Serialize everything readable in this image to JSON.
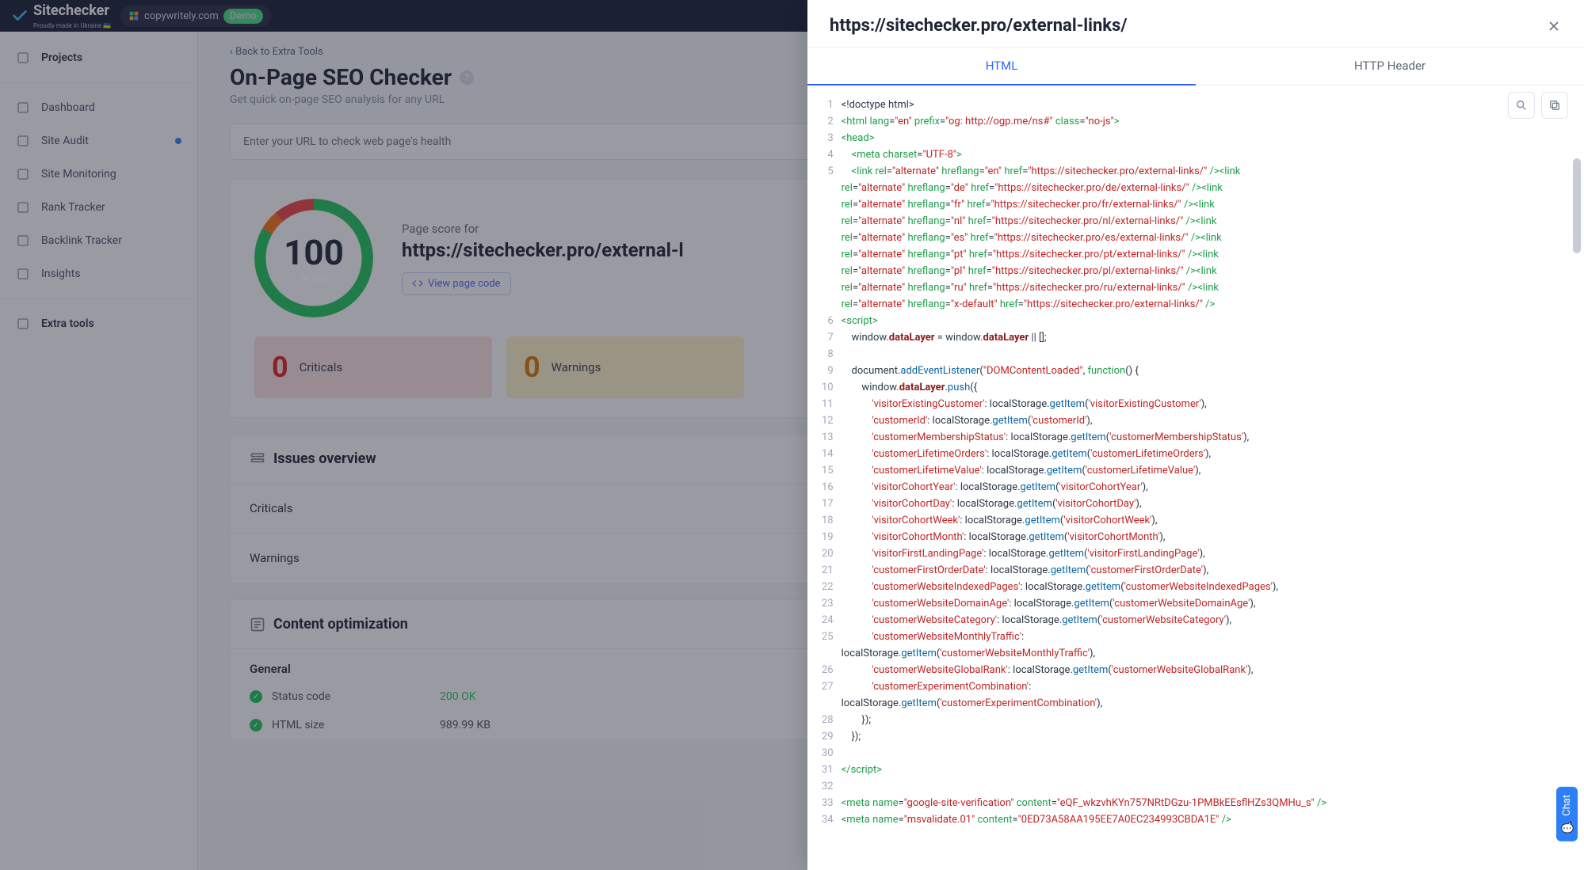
{
  "header": {
    "logo_name": "Sitechecker",
    "logo_sub": "Proudly made in Ukraine 🇺🇦",
    "demo_site": "copywritely.com",
    "demo_badge": "Demo"
  },
  "sidebar": {
    "items": [
      {
        "label": "Projects",
        "icon": "home-icon",
        "group": true
      },
      {
        "label": "Dashboard",
        "icon": "dashboard-icon"
      },
      {
        "label": "Site Audit",
        "icon": "audit-icon",
        "dot": true
      },
      {
        "label": "Site Monitoring",
        "icon": "monitor-icon"
      },
      {
        "label": "Rank Tracker",
        "icon": "rank-icon"
      },
      {
        "label": "Backlink Tracker",
        "icon": "backlink-icon"
      },
      {
        "label": "Insights",
        "icon": "insights-icon"
      },
      {
        "label": "Extra tools",
        "icon": "extra-icon",
        "group": true
      }
    ]
  },
  "main": {
    "back": "Back to Extra Tools",
    "title": "On-Page SEO Checker",
    "subtitle": "Get quick on-page SEO analysis for any URL",
    "input_placeholder": "Enter your URL to check web page's health",
    "score": {
      "value": "100",
      "of": "of 100",
      "label": "Page score for",
      "url": "https://sitechecker.pro/external-l",
      "view_code": "View page code"
    },
    "counts": {
      "criticals_n": "0",
      "criticals_t": "Criticals",
      "warn_n": "0",
      "warn_t": "Warnings"
    },
    "issues_h": "Issues overview",
    "criticals_row": "Criticals",
    "warnings_row": "Warnings",
    "content_h": "Content optimization",
    "general": "General",
    "status_k": "Status code",
    "status_v": "200 OK",
    "size_k": "HTML size",
    "size_v": "989.99 KB"
  },
  "drawer": {
    "title": "https://sitechecker.pro/external-links/",
    "tab_html": "HTML",
    "tab_header": "HTTP Header"
  },
  "code_lines": [
    [
      [
        "pun",
        "<!doctype html>"
      ]
    ],
    [
      [
        "tag",
        "<html "
      ],
      [
        "attr",
        "lang"
      ],
      [
        "pun",
        "="
      ],
      [
        "val",
        "\"en\""
      ],
      [
        "pun",
        " "
      ],
      [
        "attr",
        "prefix"
      ],
      [
        "pun",
        "="
      ],
      [
        "val",
        "\"og: http://ogp.me/ns#\""
      ],
      [
        "pun",
        " "
      ],
      [
        "attr",
        "class"
      ],
      [
        "pun",
        "="
      ],
      [
        "val",
        "\"no-js\""
      ],
      [
        "tag",
        ">"
      ]
    ],
    [
      [
        "tag",
        "<head>"
      ]
    ],
    [
      [
        "pun",
        "    "
      ],
      [
        "tag",
        "<meta "
      ],
      [
        "attr",
        "charset"
      ],
      [
        "pun",
        "="
      ],
      [
        "val",
        "\"UTF-8\""
      ],
      [
        "tag",
        ">"
      ]
    ],
    [
      [
        "pun",
        "    "
      ],
      [
        "tag",
        "<link "
      ],
      [
        "attr",
        "rel"
      ],
      [
        "pun",
        "="
      ],
      [
        "val",
        "\"alternate\""
      ],
      [
        "pun",
        " "
      ],
      [
        "attr",
        "hreflang"
      ],
      [
        "pun",
        "="
      ],
      [
        "val",
        "\"en\""
      ],
      [
        "pun",
        " "
      ],
      [
        "attr",
        "href"
      ],
      [
        "pun",
        "="
      ],
      [
        "val",
        "\"https://sitechecker.pro/external-links/\""
      ],
      [
        "tag",
        " />"
      ],
      [
        "tag",
        "<link\n"
      ],
      [
        "attr",
        "rel"
      ],
      [
        "pun",
        "="
      ],
      [
        "val",
        "\"alternate\""
      ],
      [
        "pun",
        " "
      ],
      [
        "attr",
        "hreflang"
      ],
      [
        "pun",
        "="
      ],
      [
        "val",
        "\"de\""
      ],
      [
        "pun",
        " "
      ],
      [
        "attr",
        "href"
      ],
      [
        "pun",
        "="
      ],
      [
        "val",
        "\"https://sitechecker.pro/de/external-links/\""
      ],
      [
        "tag",
        " />"
      ],
      [
        "tag",
        "<link\n"
      ],
      [
        "attr",
        "rel"
      ],
      [
        "pun",
        "="
      ],
      [
        "val",
        "\"alternate\""
      ],
      [
        "pun",
        " "
      ],
      [
        "attr",
        "hreflang"
      ],
      [
        "pun",
        "="
      ],
      [
        "val",
        "\"fr\""
      ],
      [
        "pun",
        " "
      ],
      [
        "attr",
        "href"
      ],
      [
        "pun",
        "="
      ],
      [
        "val",
        "\"https://sitechecker.pro/fr/external-links/\""
      ],
      [
        "tag",
        " />"
      ],
      [
        "tag",
        "<link\n"
      ],
      [
        "attr",
        "rel"
      ],
      [
        "pun",
        "="
      ],
      [
        "val",
        "\"alternate\""
      ],
      [
        "pun",
        " "
      ],
      [
        "attr",
        "hreflang"
      ],
      [
        "pun",
        "="
      ],
      [
        "val",
        "\"nl\""
      ],
      [
        "pun",
        " "
      ],
      [
        "attr",
        "href"
      ],
      [
        "pun",
        "="
      ],
      [
        "val",
        "\"https://sitechecker.pro/nl/external-links/\""
      ],
      [
        "tag",
        " />"
      ],
      [
        "tag",
        "<link\n"
      ],
      [
        "attr",
        "rel"
      ],
      [
        "pun",
        "="
      ],
      [
        "val",
        "\"alternate\""
      ],
      [
        "pun",
        " "
      ],
      [
        "attr",
        "hreflang"
      ],
      [
        "pun",
        "="
      ],
      [
        "val",
        "\"es\""
      ],
      [
        "pun",
        " "
      ],
      [
        "attr",
        "href"
      ],
      [
        "pun",
        "="
      ],
      [
        "val",
        "\"https://sitechecker.pro/es/external-links/\""
      ],
      [
        "tag",
        " />"
      ],
      [
        "tag",
        "<link\n"
      ],
      [
        "attr",
        "rel"
      ],
      [
        "pun",
        "="
      ],
      [
        "val",
        "\"alternate\""
      ],
      [
        "pun",
        " "
      ],
      [
        "attr",
        "hreflang"
      ],
      [
        "pun",
        "="
      ],
      [
        "val",
        "\"pt\""
      ],
      [
        "pun",
        " "
      ],
      [
        "attr",
        "href"
      ],
      [
        "pun",
        "="
      ],
      [
        "val",
        "\"https://sitechecker.pro/pt/external-links/\""
      ],
      [
        "tag",
        " />"
      ],
      [
        "tag",
        "<link\n"
      ],
      [
        "attr",
        "rel"
      ],
      [
        "pun",
        "="
      ],
      [
        "val",
        "\"alternate\""
      ],
      [
        "pun",
        " "
      ],
      [
        "attr",
        "hreflang"
      ],
      [
        "pun",
        "="
      ],
      [
        "val",
        "\"pl\""
      ],
      [
        "pun",
        " "
      ],
      [
        "attr",
        "href"
      ],
      [
        "pun",
        "="
      ],
      [
        "val",
        "\"https://sitechecker.pro/pl/external-links/\""
      ],
      [
        "tag",
        " />"
      ],
      [
        "tag",
        "<link\n"
      ],
      [
        "attr",
        "rel"
      ],
      [
        "pun",
        "="
      ],
      [
        "val",
        "\"alternate\""
      ],
      [
        "pun",
        " "
      ],
      [
        "attr",
        "hreflang"
      ],
      [
        "pun",
        "="
      ],
      [
        "val",
        "\"ru\""
      ],
      [
        "pun",
        " "
      ],
      [
        "attr",
        "href"
      ],
      [
        "pun",
        "="
      ],
      [
        "val",
        "\"https://sitechecker.pro/ru/external-links/\""
      ],
      [
        "tag",
        " />"
      ],
      [
        "tag",
        "<link\n"
      ],
      [
        "attr",
        "rel"
      ],
      [
        "pun",
        "="
      ],
      [
        "val",
        "\"alternate\""
      ],
      [
        "pun",
        " "
      ],
      [
        "attr",
        "hreflang"
      ],
      [
        "pun",
        "="
      ],
      [
        "val",
        "\"x-default\""
      ],
      [
        "pun",
        " "
      ],
      [
        "attr",
        "href"
      ],
      [
        "pun",
        "="
      ],
      [
        "val",
        "\"https://sitechecker.pro/external-links/\""
      ],
      [
        "tag",
        " />"
      ]
    ],
    [
      [
        "tag",
        "<script>"
      ]
    ],
    [
      [
        "pun",
        "    window."
      ],
      [
        "prop",
        "dataLayer"
      ],
      [
        "pun",
        " = window."
      ],
      [
        "prop",
        "dataLayer"
      ],
      [
        "pun",
        " || [];"
      ]
    ],
    [
      [
        "pun",
        ""
      ]
    ],
    [
      [
        "pun",
        "    document."
      ],
      [
        "fn",
        "addEventListener"
      ],
      [
        "pun",
        "("
      ],
      [
        "str",
        "\"DOMContentLoaded\""
      ],
      [
        "pun",
        ", "
      ],
      [
        "key",
        "function"
      ],
      [
        "pun",
        "() {"
      ]
    ],
    [
      [
        "pun",
        "        window."
      ],
      [
        "prop",
        "dataLayer"
      ],
      [
        "pun",
        "."
      ],
      [
        "fn",
        "push"
      ],
      [
        "pun",
        "({"
      ]
    ],
    [
      [
        "pun",
        "            "
      ],
      [
        "str",
        "'visitorExistingCustomer'"
      ],
      [
        "pun",
        ": localStorage."
      ],
      [
        "fn",
        "getItem"
      ],
      [
        "pun",
        "("
      ],
      [
        "str",
        "'visitorExistingCustomer'"
      ],
      [
        "pun",
        "),"
      ]
    ],
    [
      [
        "pun",
        "            "
      ],
      [
        "str",
        "'customerId'"
      ],
      [
        "pun",
        ": localStorage."
      ],
      [
        "fn",
        "getItem"
      ],
      [
        "pun",
        "("
      ],
      [
        "str",
        "'customerId'"
      ],
      [
        "pun",
        "),"
      ]
    ],
    [
      [
        "pun",
        "            "
      ],
      [
        "str",
        "'customerMembershipStatus'"
      ],
      [
        "pun",
        ": localStorage."
      ],
      [
        "fn",
        "getItem"
      ],
      [
        "pun",
        "("
      ],
      [
        "str",
        "'customerMembershipStatus'"
      ],
      [
        "pun",
        "),"
      ]
    ],
    [
      [
        "pun",
        "            "
      ],
      [
        "str",
        "'customerLifetimeOrders'"
      ],
      [
        "pun",
        ": localStorage."
      ],
      [
        "fn",
        "getItem"
      ],
      [
        "pun",
        "("
      ],
      [
        "str",
        "'customerLifetimeOrders'"
      ],
      [
        "pun",
        "),"
      ]
    ],
    [
      [
        "pun",
        "            "
      ],
      [
        "str",
        "'customerLifetimeValue'"
      ],
      [
        "pun",
        ": localStorage."
      ],
      [
        "fn",
        "getItem"
      ],
      [
        "pun",
        "("
      ],
      [
        "str",
        "'customerLifetimeValue'"
      ],
      [
        "pun",
        "),"
      ]
    ],
    [
      [
        "pun",
        "            "
      ],
      [
        "str",
        "'visitorCohortYear'"
      ],
      [
        "pun",
        ": localStorage."
      ],
      [
        "fn",
        "getItem"
      ],
      [
        "pun",
        "("
      ],
      [
        "str",
        "'visitorCohortYear'"
      ],
      [
        "pun",
        "),"
      ]
    ],
    [
      [
        "pun",
        "            "
      ],
      [
        "str",
        "'visitorCohortDay'"
      ],
      [
        "pun",
        ": localStorage."
      ],
      [
        "fn",
        "getItem"
      ],
      [
        "pun",
        "("
      ],
      [
        "str",
        "'visitorCohortDay'"
      ],
      [
        "pun",
        "),"
      ]
    ],
    [
      [
        "pun",
        "            "
      ],
      [
        "str",
        "'visitorCohortWeek'"
      ],
      [
        "pun",
        ": localStorage."
      ],
      [
        "fn",
        "getItem"
      ],
      [
        "pun",
        "("
      ],
      [
        "str",
        "'visitorCohortWeek'"
      ],
      [
        "pun",
        "),"
      ]
    ],
    [
      [
        "pun",
        "            "
      ],
      [
        "str",
        "'visitorCohortMonth'"
      ],
      [
        "pun",
        ": localStorage."
      ],
      [
        "fn",
        "getItem"
      ],
      [
        "pun",
        "("
      ],
      [
        "str",
        "'visitorCohortMonth'"
      ],
      [
        "pun",
        "),"
      ]
    ],
    [
      [
        "pun",
        "            "
      ],
      [
        "str",
        "'visitorFirstLandingPage'"
      ],
      [
        "pun",
        ": localStorage."
      ],
      [
        "fn",
        "getItem"
      ],
      [
        "pun",
        "("
      ],
      [
        "str",
        "'visitorFirstLandingPage'"
      ],
      [
        "pun",
        "),"
      ]
    ],
    [
      [
        "pun",
        "            "
      ],
      [
        "str",
        "'customerFirstOrderDate'"
      ],
      [
        "pun",
        ": localStorage."
      ],
      [
        "fn",
        "getItem"
      ],
      [
        "pun",
        "("
      ],
      [
        "str",
        "'customerFirstOrderDate'"
      ],
      [
        "pun",
        "),"
      ]
    ],
    [
      [
        "pun",
        "            "
      ],
      [
        "str",
        "'customerWebsiteIndexedPages'"
      ],
      [
        "pun",
        ": localStorage."
      ],
      [
        "fn",
        "getItem"
      ],
      [
        "pun",
        "("
      ],
      [
        "str",
        "'customerWebsiteIndexedPages'"
      ],
      [
        "pun",
        "),"
      ]
    ],
    [
      [
        "pun",
        "            "
      ],
      [
        "str",
        "'customerWebsiteDomainAge'"
      ],
      [
        "pun",
        ": localStorage."
      ],
      [
        "fn",
        "getItem"
      ],
      [
        "pun",
        "("
      ],
      [
        "str",
        "'customerWebsiteDomainAge'"
      ],
      [
        "pun",
        "),"
      ]
    ],
    [
      [
        "pun",
        "            "
      ],
      [
        "str",
        "'customerWebsiteCategory'"
      ],
      [
        "pun",
        ": localStorage."
      ],
      [
        "fn",
        "getItem"
      ],
      [
        "pun",
        "("
      ],
      [
        "str",
        "'customerWebsiteCategory'"
      ],
      [
        "pun",
        "),"
      ]
    ],
    [
      [
        "pun",
        "            "
      ],
      [
        "str",
        "'customerWebsiteMonthlyTraffic'"
      ],
      [
        "pun",
        ":\nlocalStorage."
      ],
      [
        "fn",
        "getItem"
      ],
      [
        "pun",
        "("
      ],
      [
        "str",
        "'customerWebsiteMonthlyTraffic'"
      ],
      [
        "pun",
        "),"
      ]
    ],
    [
      [
        "pun",
        "            "
      ],
      [
        "str",
        "'customerWebsiteGlobalRank'"
      ],
      [
        "pun",
        ": localStorage."
      ],
      [
        "fn",
        "getItem"
      ],
      [
        "pun",
        "("
      ],
      [
        "str",
        "'customerWebsiteGlobalRank'"
      ],
      [
        "pun",
        "),"
      ]
    ],
    [
      [
        "pun",
        "            "
      ],
      [
        "str",
        "'customerExperimentCombination'"
      ],
      [
        "pun",
        ":\nlocalStorage."
      ],
      [
        "fn",
        "getItem"
      ],
      [
        "pun",
        "("
      ],
      [
        "str",
        "'customerExperimentCombination'"
      ],
      [
        "pun",
        "),"
      ]
    ],
    [
      [
        "pun",
        "        });"
      ]
    ],
    [
      [
        "pun",
        "    });"
      ]
    ],
    [
      [
        "pun",
        ""
      ]
    ],
    [
      [
        "tag",
        "</script>"
      ]
    ],
    [
      [
        "pun",
        ""
      ]
    ],
    [
      [
        "tag",
        "<meta "
      ],
      [
        "attr",
        "name"
      ],
      [
        "pun",
        "="
      ],
      [
        "val",
        "\"google-site-verification\""
      ],
      [
        "pun",
        " "
      ],
      [
        "attr",
        "content"
      ],
      [
        "pun",
        "="
      ],
      [
        "val",
        "\"eQF_wkzvhKYn757NRtDGzu-1PMBkEEsflHZs3QMHu_s\""
      ],
      [
        "tag",
        " />"
      ]
    ],
    [
      [
        "tag",
        "<meta "
      ],
      [
        "attr",
        "name"
      ],
      [
        "pun",
        "="
      ],
      [
        "val",
        "\"msvalidate.01\""
      ],
      [
        "pun",
        " "
      ],
      [
        "attr",
        "content"
      ],
      [
        "pun",
        "="
      ],
      [
        "val",
        "\"0ED73A58AA195EE7A0EC234993CBDA1E\""
      ],
      [
        "tag",
        " />"
      ]
    ]
  ],
  "chat": "Chat"
}
